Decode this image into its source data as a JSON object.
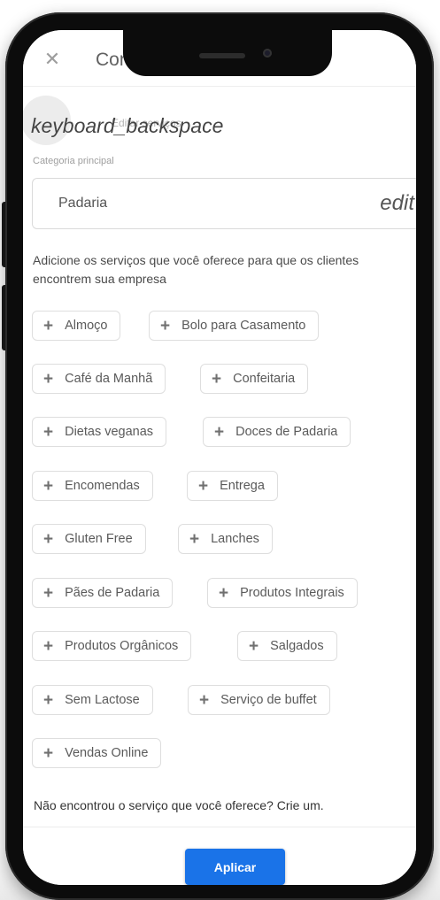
{
  "header": {
    "close_icon": "close-icon",
    "title": "Conecte-se com os clientes"
  },
  "back": {
    "icon_text": "keyboard_backspace",
    "underlying_text": "Editar serviços"
  },
  "category": {
    "label": "Categoria principal",
    "value": "Padaria",
    "edit_icon_text": "edit"
  },
  "help_text": "Adicione os serviços que você oferece para que os clientes encontrem sua empresa",
  "services": [
    "Almoço",
    "Bolo para Casamento",
    "Café da Manhã",
    "Confeitaria",
    "Dietas veganas",
    "Doces de Padaria",
    "Encomendas",
    "Entrega",
    "Gluten Free",
    "Lanches",
    "Pães de Padaria",
    "Produtos Integrais",
    "Produtos Orgânicos",
    "Salgados",
    "Sem Lactose",
    "Serviço de buffet",
    "Vendas Online"
  ],
  "chip_plus": "+",
  "footer_prompt": "Não encontrou o serviço que você oferece? Crie um.",
  "apply_label": "Aplicar",
  "colors": {
    "accent": "#1a73e8",
    "phone_frame": "#0c0c0c"
  }
}
